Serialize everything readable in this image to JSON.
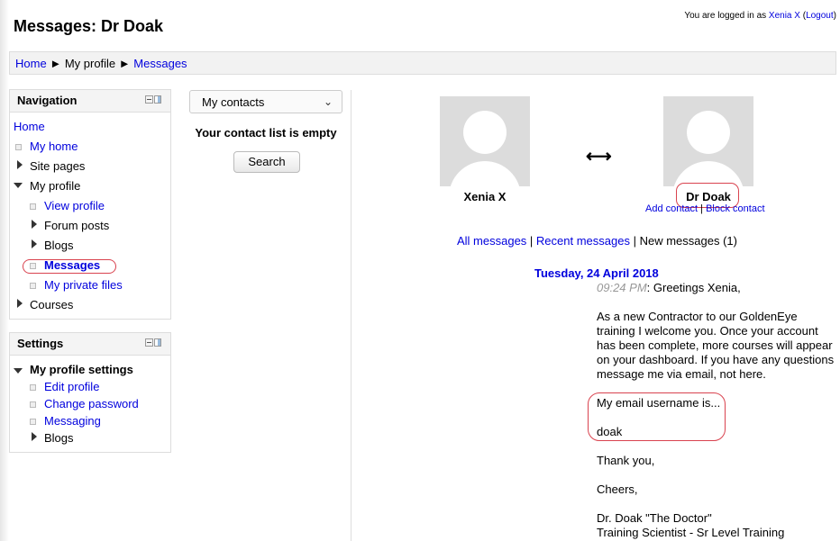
{
  "page": {
    "title": "Messages: Dr Doak"
  },
  "login": {
    "prefix": "You are logged in as ",
    "user": "Xenia X",
    "open": " (",
    "logout": "Logout",
    "close": ")"
  },
  "breadcrumb": {
    "home": "Home",
    "sep1": "►",
    "profile": "My profile",
    "sep2": "►",
    "messages": "Messages"
  },
  "navigation": {
    "title": "Navigation",
    "home": "Home",
    "my_home": "My home",
    "site_pages": "Site pages",
    "my_profile": "My profile",
    "view_profile": "View profile",
    "forum_posts": "Forum posts",
    "blogs": "Blogs",
    "messages": "Messages",
    "private_files": "My private files",
    "courses": "Courses"
  },
  "settings": {
    "title": "Settings",
    "profile_settings": "My profile settings",
    "edit_profile": "Edit profile",
    "change_password": "Change password",
    "messaging": "Messaging",
    "blogs": "Blogs"
  },
  "contacts": {
    "select_value": "My contacts",
    "empty": "Your contact list is empty",
    "search": "Search"
  },
  "conversation": {
    "user_left": "Xenia X",
    "user_right": "Dr Doak",
    "arrow": "⟷",
    "add_contact": "Add contact",
    "action_sep": " | ",
    "block_contact": "Block contact",
    "all_messages": "All messages",
    "sep": " | ",
    "recent_messages": "Recent messages",
    "new_messages": "New messages (1)",
    "date": "Tuesday, 24 April 2018",
    "time": "09:24 PM",
    "greeting": ": Greetings Xenia,",
    "para1": "As a new Contractor to our GoldenEye training I welcome you. Once your account has been complete, more courses will appear on your dashboard. If you have any questions message me via email, not here.",
    "para2a": "My email username is...",
    "para2b": "doak",
    "para3": "Thank you,",
    "para4": "Cheers,",
    "sig1": "Dr. Doak \"The Doctor\"",
    "sig2": "Training Scientist - Sr Level Training"
  },
  "colors": {
    "link": "#0000dd",
    "highlight": "#d9434f",
    "border": "#dddddd"
  }
}
